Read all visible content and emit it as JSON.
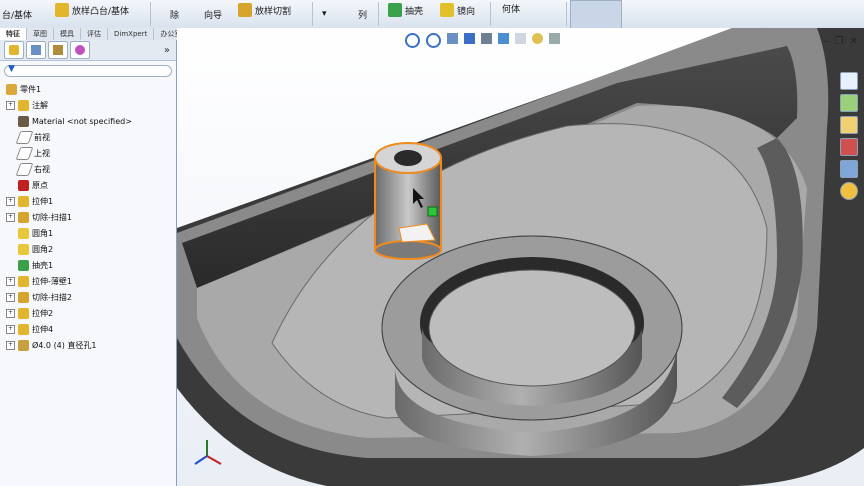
{
  "ribbon": {
    "boss_base": "台/基体",
    "lofted_boss": "放样凸台/基体",
    "extruded_cut_label": "除",
    "wizard": "向导",
    "lofted_cut": "放样切割",
    "pattern": "列",
    "shell": "抽壳",
    "mirror": "镜向",
    "body": "何体"
  },
  "tabs": [
    "特征",
    "草图",
    "模具",
    "评估",
    "DimXpert",
    "办公室产品"
  ],
  "tree": {
    "root": "零件1",
    "items": [
      {
        "label": "注解",
        "expand": true,
        "icon": "annotations-icon"
      },
      {
        "label": "Material <not specified>",
        "expand": false,
        "icon": "material-icon"
      },
      {
        "label": "前视",
        "expand": false,
        "icon": "plane-icon"
      },
      {
        "label": "上视",
        "expand": false,
        "icon": "plane-icon"
      },
      {
        "label": "右视",
        "expand": false,
        "icon": "plane-icon"
      },
      {
        "label": "原点",
        "expand": false,
        "icon": "origin-icon"
      },
      {
        "label": "拉伸1",
        "expand": true,
        "icon": "extrude-icon"
      },
      {
        "label": "切除-扫描1",
        "expand": true,
        "icon": "cut-sweep-icon"
      },
      {
        "label": "圆角1",
        "expand": false,
        "icon": "fillet-icon"
      },
      {
        "label": "圆角2",
        "expand": false,
        "icon": "fillet-icon"
      },
      {
        "label": "抽壳1",
        "expand": false,
        "icon": "shell-icon"
      },
      {
        "label": "拉伸-薄壁1",
        "expand": true,
        "icon": "extrude-thin-icon"
      },
      {
        "label": "切除-扫描2",
        "expand": true,
        "icon": "cut-sweep-icon"
      },
      {
        "label": "拉伸2",
        "expand": true,
        "icon": "extrude-icon"
      },
      {
        "label": "拉伸4",
        "expand": true,
        "icon": "extrude-icon"
      },
      {
        "label": "Ø4.0 (4) 直径孔1",
        "expand": true,
        "icon": "hole-icon"
      }
    ]
  },
  "colors": {
    "accent": "#f08a1c",
    "selection": "#2ec43a",
    "ribbon": "#dfe6ef"
  }
}
